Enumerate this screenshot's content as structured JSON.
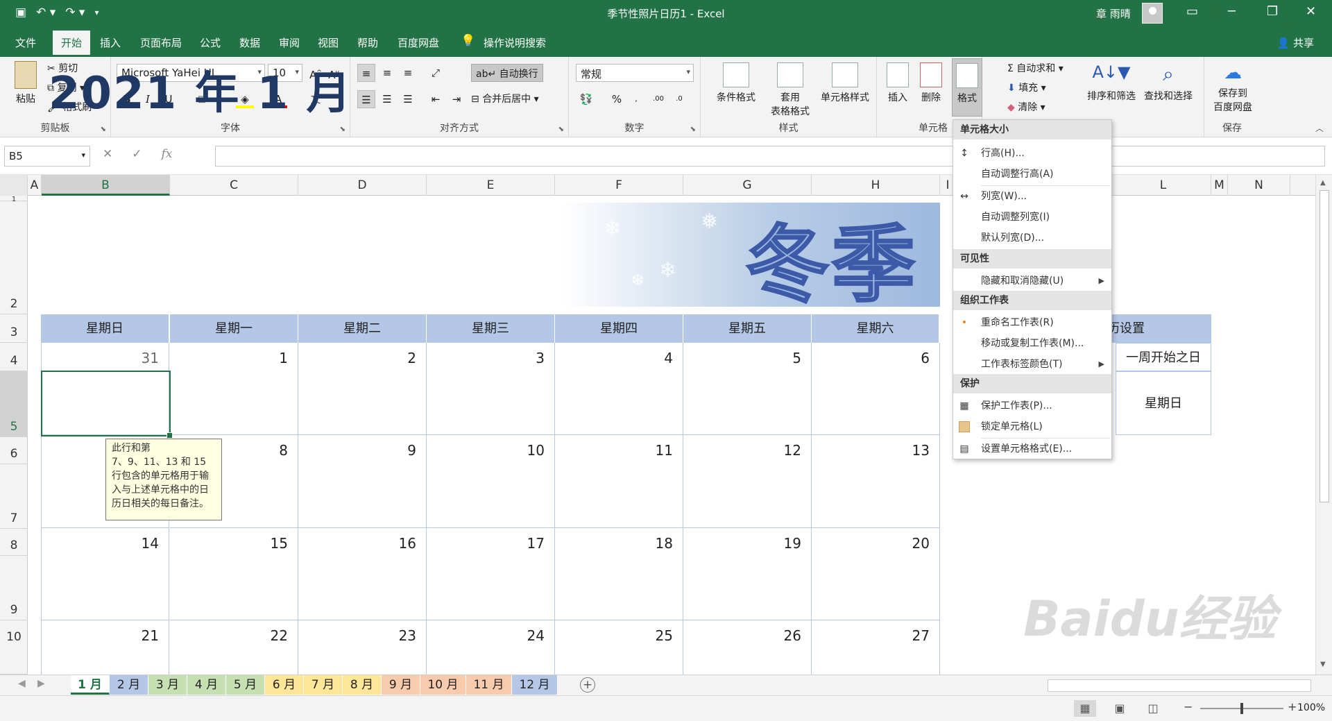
{
  "window": {
    "title": "季节性照片日历1  -  Excel",
    "user": "章 雨晴"
  },
  "tabs": [
    "文件",
    "开始",
    "插入",
    "页面布局",
    "公式",
    "数据",
    "审阅",
    "视图",
    "帮助",
    "百度网盘"
  ],
  "active_tab": "开始",
  "tell_me": "操作说明搜索",
  "share": "共享",
  "ribbon": {
    "clipboard": {
      "paste": "粘贴",
      "cut": "剪切",
      "copy": "复制",
      "format_painter": "格式刷",
      "label": "剪贴板"
    },
    "font": {
      "name": "Microsoft YaHei UI",
      "size": "10",
      "label": "字体"
    },
    "alignment": {
      "wrap": "自动换行",
      "merge": "合并后居中",
      "label": "对齐方式"
    },
    "number": {
      "format": "常规",
      "label": "数字"
    },
    "styles": {
      "conditional": "条件格式",
      "table_line1": "套用",
      "table_line2": "表格格式",
      "cell_styles": "单元格样式",
      "label": "样式"
    },
    "cells": {
      "insert": "插入",
      "delete": "删除",
      "format": "格式",
      "label": "单元格"
    },
    "editing": {
      "autosum": "自动求和",
      "fill": "填充",
      "clear": "清除",
      "sort": "排序和筛选",
      "find": "查找和选择"
    },
    "save": {
      "save_line1": "保存到",
      "save_line2": "百度网盘",
      "label": "保存"
    }
  },
  "name_box": "B5",
  "columns": [
    "A",
    "B",
    "C",
    "D",
    "E",
    "F",
    "G",
    "H",
    "I",
    "L",
    "M",
    "N"
  ],
  "rows": [
    "1",
    "2",
    "3",
    "4",
    "5",
    "6",
    "7",
    "8",
    "9",
    "10"
  ],
  "calendar": {
    "title": "2021 年 1 月",
    "season": "冬季",
    "weekdays": [
      "星期日",
      "星期一",
      "星期二",
      "星期三",
      "星期四",
      "星期五",
      "星期六"
    ],
    "weeks": [
      [
        "31",
        "1",
        "2",
        "3",
        "4",
        "5",
        "6"
      ],
      [
        "",
        "8",
        "9",
        "10",
        "11",
        "12",
        "13"
      ],
      [
        "14",
        "15",
        "16",
        "17",
        "18",
        "19",
        "20"
      ],
      [
        "21",
        "22",
        "23",
        "24",
        "25",
        "26",
        "27"
      ]
    ],
    "settings_header": "历设置",
    "week_start_label": "一周开始之日",
    "week_start_value": "星期日"
  },
  "comment": "此行和第\n7、9、11、13 和 15 行包含的单元格用于输入与上述单元格中的日历日相关的每日备注。",
  "menu": {
    "sections": [
      "单元格大小",
      "可见性",
      "组织工作表",
      "保护"
    ],
    "items": [
      "行高(H)...",
      "自动调整行高(A)",
      "列宽(W)...",
      "自动调整列宽(I)",
      "默认列宽(D)...",
      "隐藏和取消隐藏(U)",
      "重命名工作表(R)",
      "移动或复制工作表(M)...",
      "工作表标签颜色(T)",
      "保护工作表(P)...",
      "锁定单元格(L)",
      "设置单元格格式(E)..."
    ]
  },
  "sheets": [
    "1 月",
    "2 月",
    "3 月",
    "4 月",
    "5 月",
    "6 月",
    "7 月",
    "8 月",
    "9 月",
    "10 月",
    "11 月",
    "12 月"
  ],
  "sheet_colors": [
    "#ffffff",
    "#b4c7e7",
    "#c6e0b4",
    "#c6e0b4",
    "#c6e0b4",
    "#ffe699",
    "#ffe699",
    "#ffe699",
    "#f8cbad",
    "#f8cbad",
    "#f8cbad",
    "#b4c7e7"
  ],
  "zoom": "100%",
  "watermark": "Baidu经验",
  "watermark_url": "jingyan.baidu.com"
}
